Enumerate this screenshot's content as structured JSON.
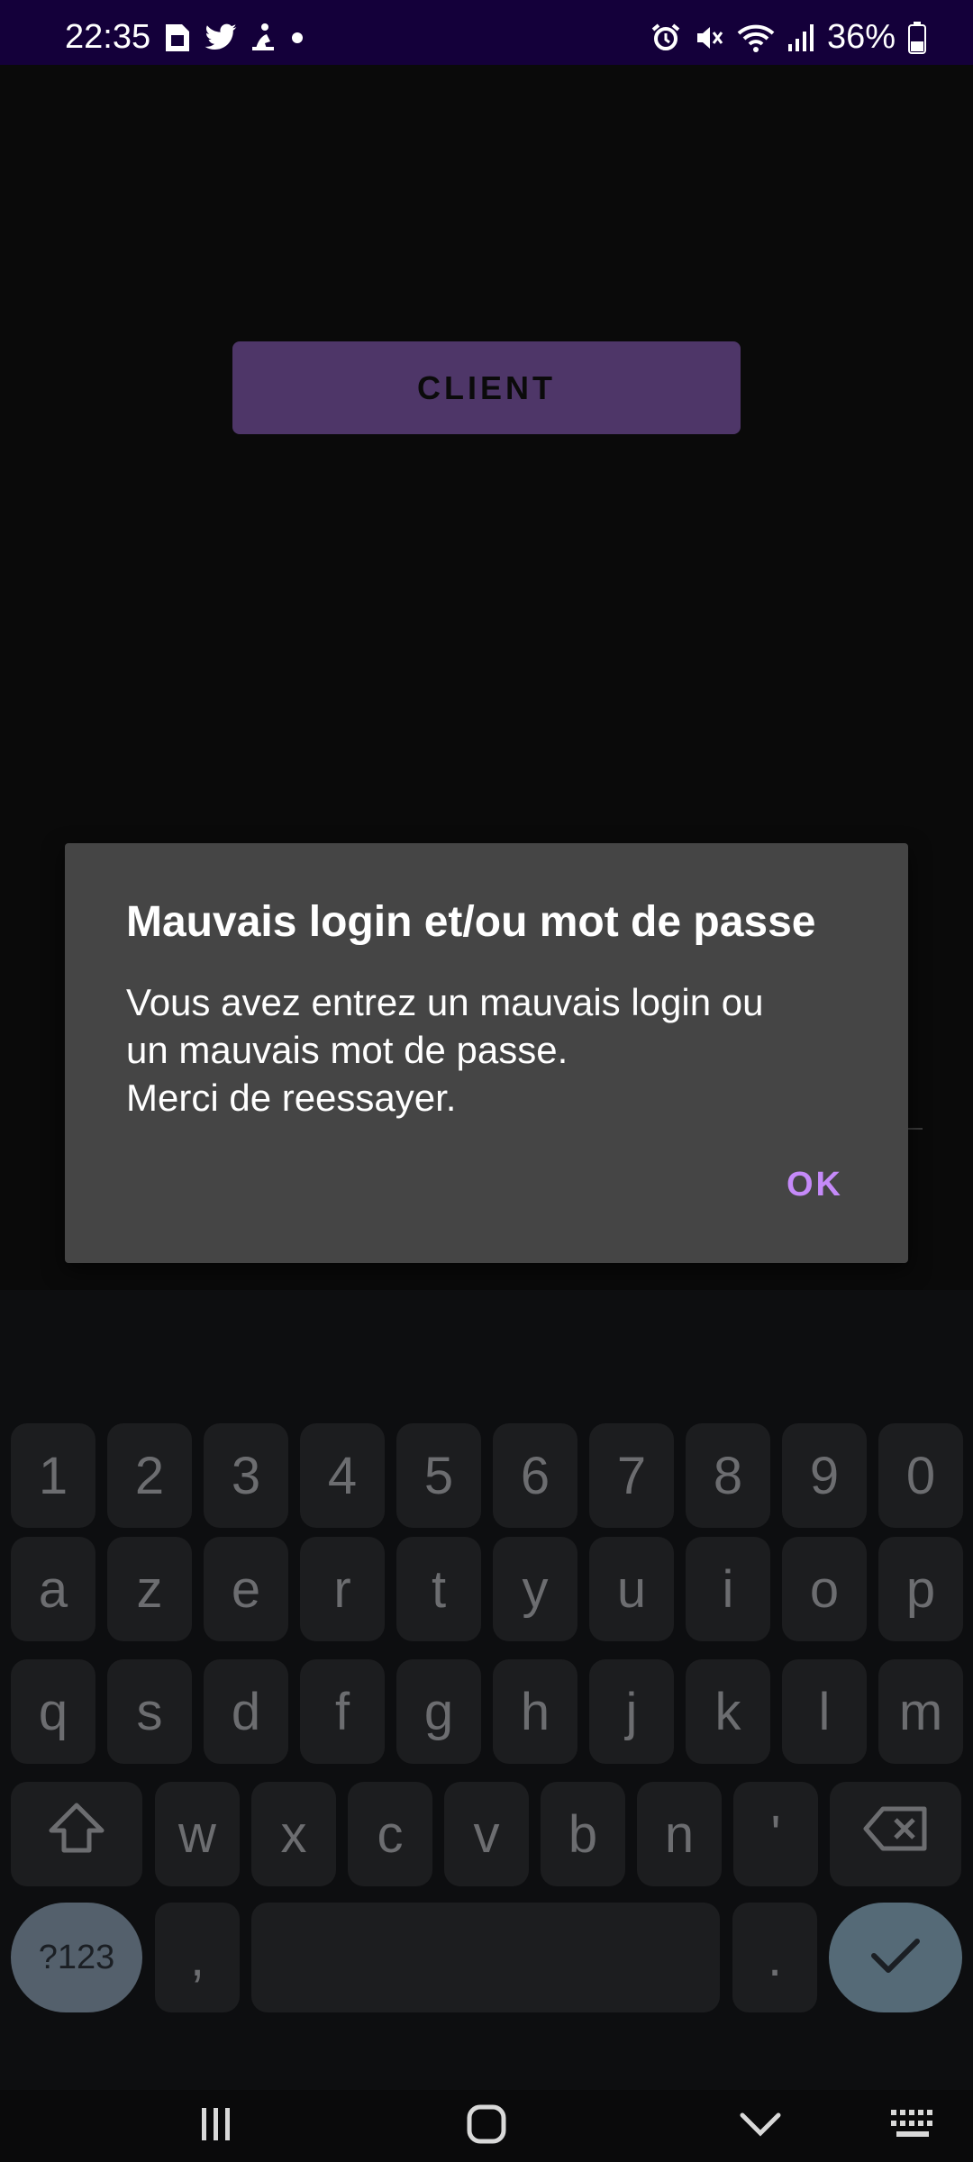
{
  "status_bar": {
    "time": "22:35",
    "left_icons": [
      "sim-card-icon",
      "twitter-icon",
      "pilgrim-icon",
      "dot-icon"
    ],
    "right_icons": [
      "alarm-icon",
      "mute-icon",
      "wifi-icon",
      "signal-icon",
      "battery-icon"
    ],
    "battery_percent": "36%"
  },
  "app": {
    "client_button_label": "CLIENT"
  },
  "dialog": {
    "title": "Mauvais login et/ou mot de passe",
    "message": "Vous avez entrez un mauvais login ou\nun mauvais mot de passe.\nMerci de reessayer.",
    "ok_label": "OK"
  },
  "keyboard": {
    "row_numbers": [
      "1",
      "2",
      "3",
      "4",
      "5",
      "6",
      "7",
      "8",
      "9",
      "0"
    ],
    "row_1": [
      "a",
      "z",
      "e",
      "r",
      "t",
      "y",
      "u",
      "i",
      "o",
      "p"
    ],
    "row_2": [
      "q",
      "s",
      "d",
      "f",
      "g",
      "h",
      "j",
      "k",
      "l",
      "m"
    ],
    "row_3": [
      "w",
      "x",
      "c",
      "v",
      "b",
      "n",
      "'"
    ],
    "symbols_label": "?123",
    "comma_label": ",",
    "period_label": ".",
    "icons": {
      "shift": "shift-icon",
      "backspace": "backspace-icon",
      "enter": "check-icon"
    }
  },
  "nav_bar": {
    "icons": [
      "recents-icon",
      "home-icon",
      "back-icon",
      "keyboard-icon"
    ]
  },
  "colors": {
    "status_bar_bg": "#14003a",
    "client_button_bg": "#4e3668",
    "dialog_bg": "#454545",
    "accent_ok": "#c58af9",
    "field_focus_line": "#0b5c55"
  }
}
